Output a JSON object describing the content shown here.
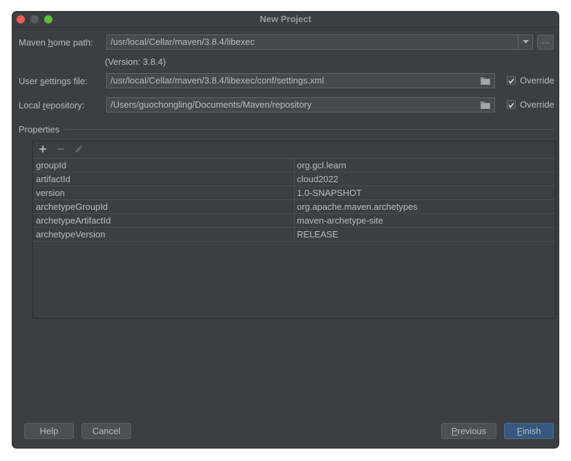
{
  "window": {
    "title": "New Project"
  },
  "maven_home": {
    "label_prefix": "Maven ",
    "label_mnemonic": "h",
    "label_suffix": "ome path:",
    "value": "/usr/local/Cellar/maven/3.8.4/libexec",
    "browse_label": "...",
    "version_text": "(Version: 3.8.4)"
  },
  "user_settings": {
    "label_prefix": "User ",
    "label_mnemonic": "s",
    "label_suffix": "ettings file:",
    "value": "/usr/local/Cellar/maven/3.8.4/libexec/conf/settings.xml",
    "override_label": "Override",
    "override_checked": true
  },
  "local_repo": {
    "label_prefix": "Local ",
    "label_mnemonic": "r",
    "label_suffix": "epository:",
    "value": "/Users/guochongling/Documents/Maven/repository",
    "override_label": "Override",
    "override_checked": true
  },
  "properties": {
    "section_label": "Properties",
    "rows": [
      {
        "key": "groupId",
        "value": "org.gcl.learn"
      },
      {
        "key": "artifactId",
        "value": "cloud2022"
      },
      {
        "key": "version",
        "value": "1.0-SNAPSHOT"
      },
      {
        "key": "archetypeGroupId",
        "value": "org.apache.maven.archetypes"
      },
      {
        "key": "archetypeArtifactId",
        "value": "maven-archetype-site"
      },
      {
        "key": "archetypeVersion",
        "value": "RELEASE"
      }
    ]
  },
  "buttons": {
    "help": "Help",
    "cancel": "Cancel",
    "previous_mnemonic": "P",
    "previous_rest": "revious",
    "finish_mnemonic": "F",
    "finish_rest": "inish"
  },
  "colors": {
    "dialog_bg": "#3c3f41",
    "field_bg": "#45494a",
    "primary_button": "#365880",
    "close": "#ee5c50",
    "maximize": "#5ac039"
  }
}
